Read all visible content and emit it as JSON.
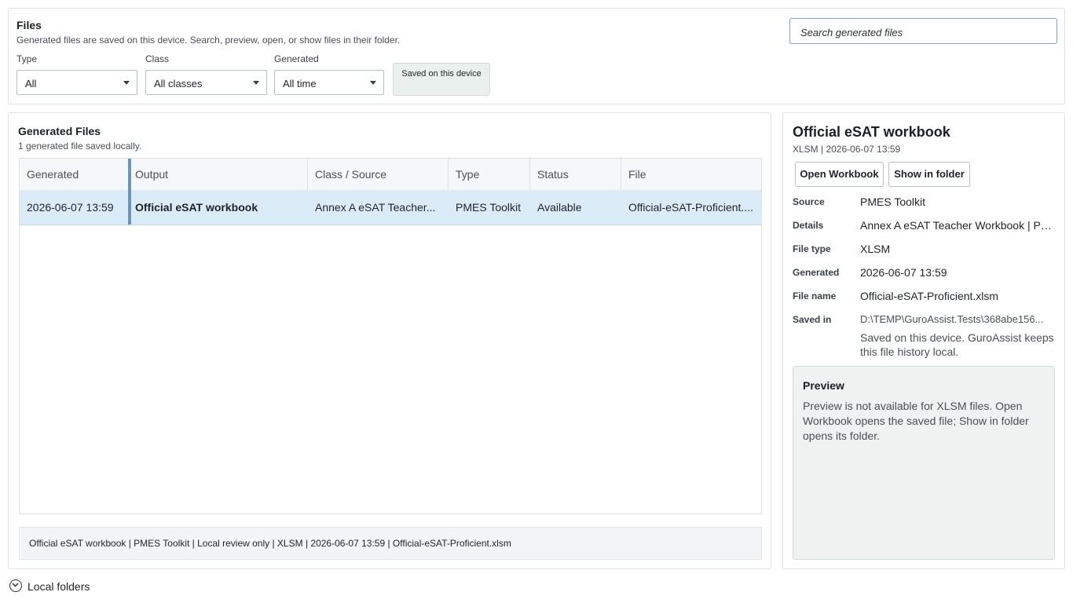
{
  "header": {
    "title": "Files",
    "subtitle": "Generated files are saved on this device. Search, preview, open, or show files in their folder.",
    "search_placeholder": "Search generated files"
  },
  "filters": {
    "type": {
      "label": "Type",
      "value": "All"
    },
    "class": {
      "label": "Class",
      "value": "All classes"
    },
    "generated": {
      "label": "Generated",
      "value": "All time"
    },
    "saved_chip": "Saved on this device"
  },
  "files": {
    "title": "Generated Files",
    "count_text": "1 generated file saved locally.",
    "columns": [
      "Generated",
      "Output",
      "Class / Source",
      "Type",
      "Status",
      "File"
    ],
    "rows": [
      {
        "generated": "2026-06-07 13:59",
        "output": "Official eSAT workbook",
        "class_source": "Annex A eSAT Teacher...",
        "type": "PMES Toolkit",
        "status": "Available",
        "file": "Official-eSAT-Proficient...."
      }
    ],
    "summary": "Official eSAT workbook | PMES Toolkit | Local review only | XLSM | 2026-06-07 13:59 | Official-eSAT-Proficient.xlsm"
  },
  "detail": {
    "title": "Official eSAT workbook",
    "meta": "XLSM | 2026-06-07 13:59",
    "open_button": "Open Workbook",
    "folder_button": "Show in folder",
    "fields": [
      {
        "label": "Source",
        "value": "PMES Toolkit"
      },
      {
        "label": "Details",
        "value": "Annex A eSAT Teacher Workbook | Pro..."
      },
      {
        "label": "File type",
        "value": "XLSM"
      },
      {
        "label": "Generated",
        "value": "2026-06-07 13:59"
      },
      {
        "label": "File name",
        "value": "Official-eSAT-Proficient.xlsm"
      },
      {
        "label": "Saved in",
        "value": "D:\\TEMP\\GuroAssist.Tests\\368abe156..."
      }
    ],
    "saved_note": "Saved on this device. GuroAssist keeps this file history local.",
    "preview": {
      "heading": "Preview",
      "text": "Preview is not available for XLSM files. Open Workbook opens the saved file; Show in folder opens its folder."
    }
  },
  "local_folders": {
    "label": "Local folders"
  },
  "colors": {
    "accent_border": "#7fa7c7",
    "selected_row": "#dcebf8",
    "chip_bg": "#e9f0ee",
    "preview_bg": "#eef2f0"
  }
}
